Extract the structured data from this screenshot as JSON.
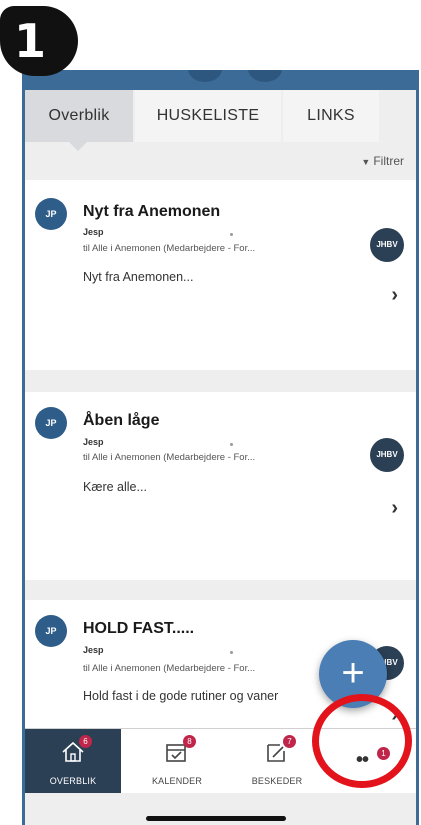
{
  "step": {
    "number": "1"
  },
  "tabs": [
    {
      "label": "Overblik",
      "active": true
    },
    {
      "label": "HUSKELISTE",
      "active": false
    },
    {
      "label": "LINKS",
      "active": false
    }
  ],
  "filter": {
    "label": "Filtrer"
  },
  "posts": [
    {
      "initials": "JP",
      "title": "Nyt fra Anemonen",
      "author": "Jesp",
      "recipients": "til Alle i Anemonen (Medarbejdere - For...",
      "preview": "Nyt fra Anemonen...",
      "badge": "JHBV"
    },
    {
      "initials": "JP",
      "title": "Åben låge",
      "author": "Jesp",
      "recipients": "til Alle i Anemonen (Medarbejdere - For...",
      "preview": "Kære alle...",
      "badge": "JHBV"
    },
    {
      "initials": "JP",
      "title": "HOLD FAST.....",
      "author": "Jesp",
      "recipients": "til Alle i Anemonen (Medarbejdere - For...",
      "preview": "Hold fast i de gode rutiner og vaner",
      "badge": "JHBV"
    }
  ],
  "fab": {
    "label": "+"
  },
  "nav": {
    "items": [
      {
        "label": "OVERBLIK",
        "badge": "6",
        "icon": "home-icon",
        "active": true
      },
      {
        "label": "KALENDER",
        "badge": "8",
        "icon": "calendar-icon",
        "active": false
      },
      {
        "label": "BESKEDER",
        "badge": "7",
        "icon": "message-icon",
        "active": false
      },
      {
        "label": "",
        "badge": "1",
        "icon": "more-icon",
        "active": false
      }
    ]
  },
  "colors": {
    "brand": "#3c6b98",
    "active_nav": "#2b3f55",
    "badge": "#c0254a",
    "highlight": "#e3131b"
  }
}
